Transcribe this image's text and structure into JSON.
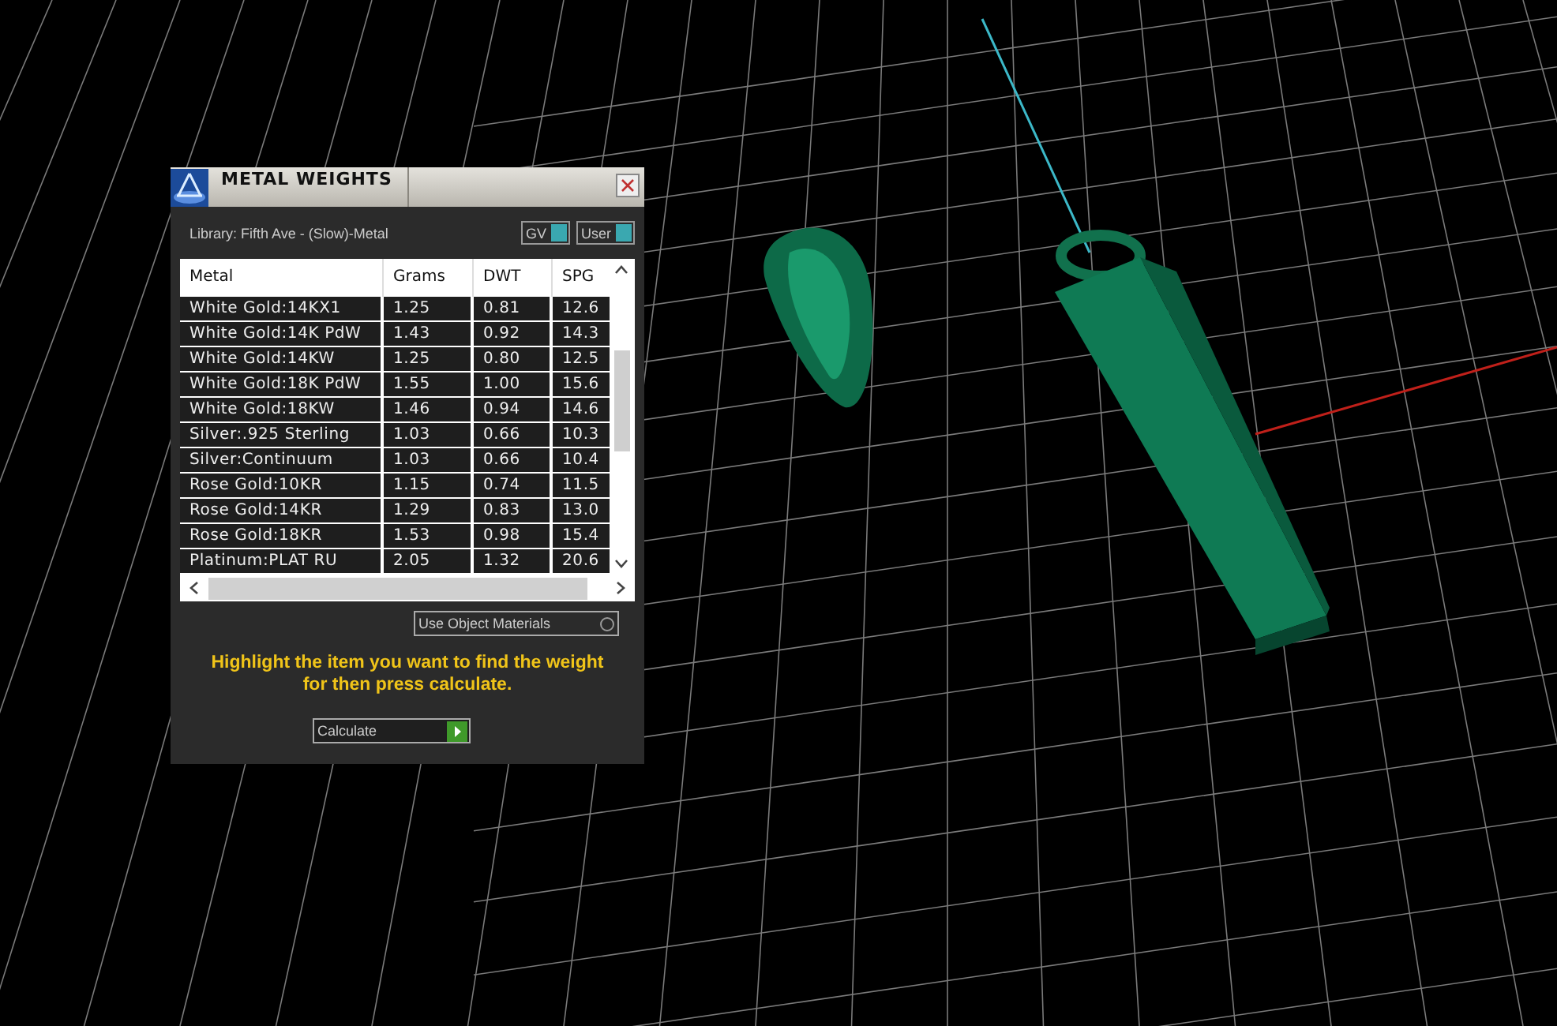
{
  "window": {
    "title": "METAL WEIGHTS"
  },
  "library": {
    "label": "Library: Fifth Ave - (Slow)-Metal"
  },
  "toggles": [
    {
      "label": "GV",
      "on": true
    },
    {
      "label": "User",
      "on": true
    }
  ],
  "table": {
    "columns": [
      "Metal",
      "Grams",
      "DWT",
      "SPG"
    ],
    "rows": [
      [
        "White Gold:14KX1",
        "1.25",
        "0.81",
        "12.6"
      ],
      [
        "White Gold:14K PdW",
        "1.43",
        "0.92",
        "14.3"
      ],
      [
        "White Gold:14KW",
        "1.25",
        "0.80",
        "12.5"
      ],
      [
        "White Gold:18K PdW",
        "1.55",
        "1.00",
        "15.6"
      ],
      [
        "White Gold:18KW",
        "1.46",
        "0.94",
        "14.6"
      ],
      [
        "Silver:.925 Sterling",
        "1.03",
        "0.66",
        "10.3"
      ],
      [
        "Silver:Continuum",
        "1.03",
        "0.66",
        "10.4"
      ],
      [
        "Rose Gold:10KR",
        "1.15",
        "0.74",
        "11.5"
      ],
      [
        "Rose Gold:14KR",
        "1.29",
        "0.83",
        "13.0"
      ],
      [
        "Rose Gold:18KR",
        "1.53",
        "0.98",
        "15.4"
      ],
      [
        "Platinum:PLAT RU",
        "2.05",
        "1.32",
        "20.6"
      ]
    ]
  },
  "use_object_materials": {
    "label": "Use Object Materials",
    "on": false
  },
  "hint": "Highlight the item you want to find the weight for then press calculate.",
  "calculate_button": {
    "label": "Calculate"
  }
}
